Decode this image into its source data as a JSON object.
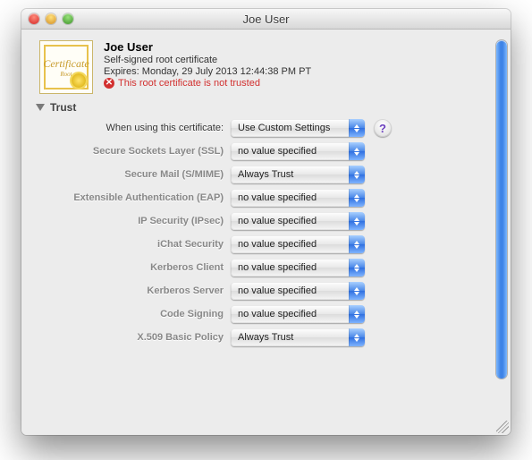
{
  "window": {
    "title": "Joe User"
  },
  "certificate": {
    "name": "Joe User",
    "type": "Self-signed root certificate",
    "expires_label": "Expires: Monday, 29 July 2013 12:44:38 PM PT",
    "warning": "This root certificate is not trusted",
    "icon_title": "Certificate",
    "icon_sub": "Root"
  },
  "trust": {
    "section_label": "Trust",
    "usage_label": "When using this certificate:",
    "usage_value": "Use Custom Settings",
    "help": "?",
    "rows": [
      {
        "label": "Secure Sockets Layer (SSL)",
        "value": "no value specified"
      },
      {
        "label": "Secure Mail (S/MIME)",
        "value": "Always Trust"
      },
      {
        "label": "Extensible Authentication (EAP)",
        "value": "no value specified"
      },
      {
        "label": "IP Security (IPsec)",
        "value": "no value specified"
      },
      {
        "label": "iChat Security",
        "value": "no value specified"
      },
      {
        "label": "Kerberos Client",
        "value": "no value specified"
      },
      {
        "label": "Kerberos Server",
        "value": "no value specified"
      },
      {
        "label": "Code Signing",
        "value": "no value specified"
      },
      {
        "label": "X.509 Basic Policy",
        "value": "Always Trust"
      }
    ]
  }
}
